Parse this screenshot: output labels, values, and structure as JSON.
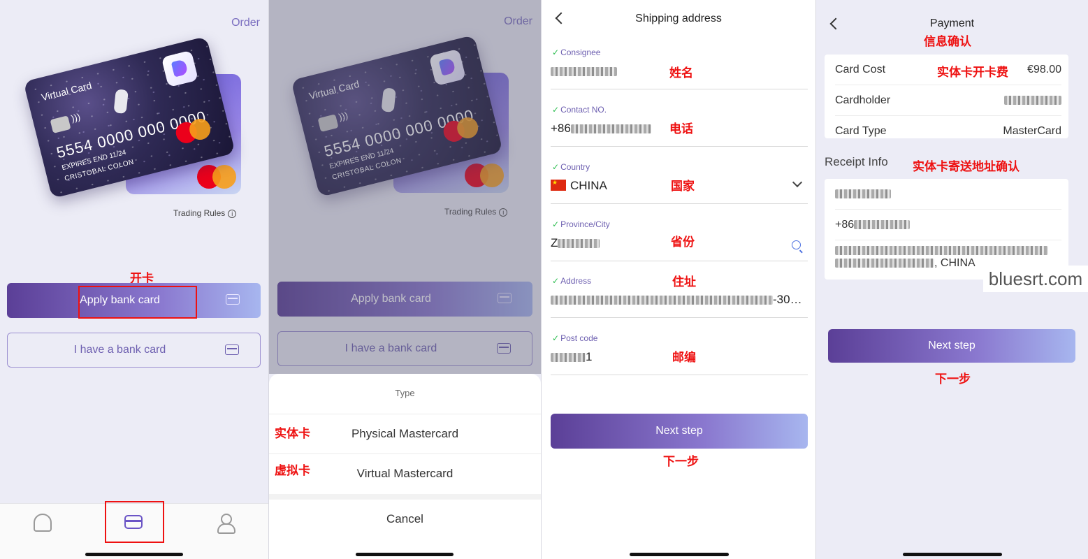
{
  "panel1": {
    "order_label": "Order",
    "card": {
      "title": "Virtual Card",
      "number": "5554  0000 000 0000",
      "expiry": "EXPIRES END 11/24",
      "holder": "CRISTOBAL COLON",
      "brand_logo": "Unioncash"
    },
    "trading_rules": "Trading Rules",
    "annotation_open_card": "开卡",
    "apply_button": "Apply bank card",
    "have_card_button": "I have a bank card",
    "tabs": [
      "home-icon",
      "card-icon",
      "user-icon"
    ],
    "active_tab": "card"
  },
  "panel2": {
    "order_label": "Order",
    "apply_button": "Apply bank card",
    "have_card_button": "I have a bank card",
    "trading_rules": "Trading Rules",
    "sheet": {
      "title": "Type",
      "options": [
        {
          "label": "Physical Mastercard",
          "annotation": "实体卡"
        },
        {
          "label": "Virtual Mastercard",
          "annotation": "虚拟卡"
        }
      ],
      "cancel": "Cancel"
    }
  },
  "panel3": {
    "title": "Shipping address",
    "fields": [
      {
        "label": "Consignee",
        "value": "",
        "annotation": "姓名"
      },
      {
        "label": "Contact NO.",
        "value": "+86",
        "annotation": "电话"
      },
      {
        "label": "Country",
        "value": "CHINA",
        "annotation": "国家"
      },
      {
        "label": "Province/City",
        "value": "Z",
        "annotation": "省份"
      },
      {
        "label": "Address",
        "value": "-30…",
        "annotation": "住址"
      },
      {
        "label": "Post code",
        "value": "1",
        "annotation": "邮编"
      }
    ],
    "next_button": "Next step",
    "annotation_next": "下一步"
  },
  "panel4": {
    "title": "Payment",
    "annotation_title": "信息确认",
    "rows": [
      {
        "key": "Card Cost",
        "value": "€98.00",
        "annotation": "实体卡开卡费"
      },
      {
        "key": "Cardholder",
        "value": ""
      },
      {
        "key": "Card Type",
        "value": "MasterCard"
      }
    ],
    "receipt_title": "Receipt Info",
    "annotation_receipt": "实体卡寄送地址确认",
    "receipt_phone_prefix": "+86",
    "receipt_address_suffix": ", CHINA",
    "next_button": "Next step",
    "annotation_next": "下一步",
    "watermark": "bluesrt.com"
  },
  "colors": {
    "accent": "#6b55c6",
    "annotation_red": "#ee1111",
    "check_green": "#2dbe50"
  }
}
